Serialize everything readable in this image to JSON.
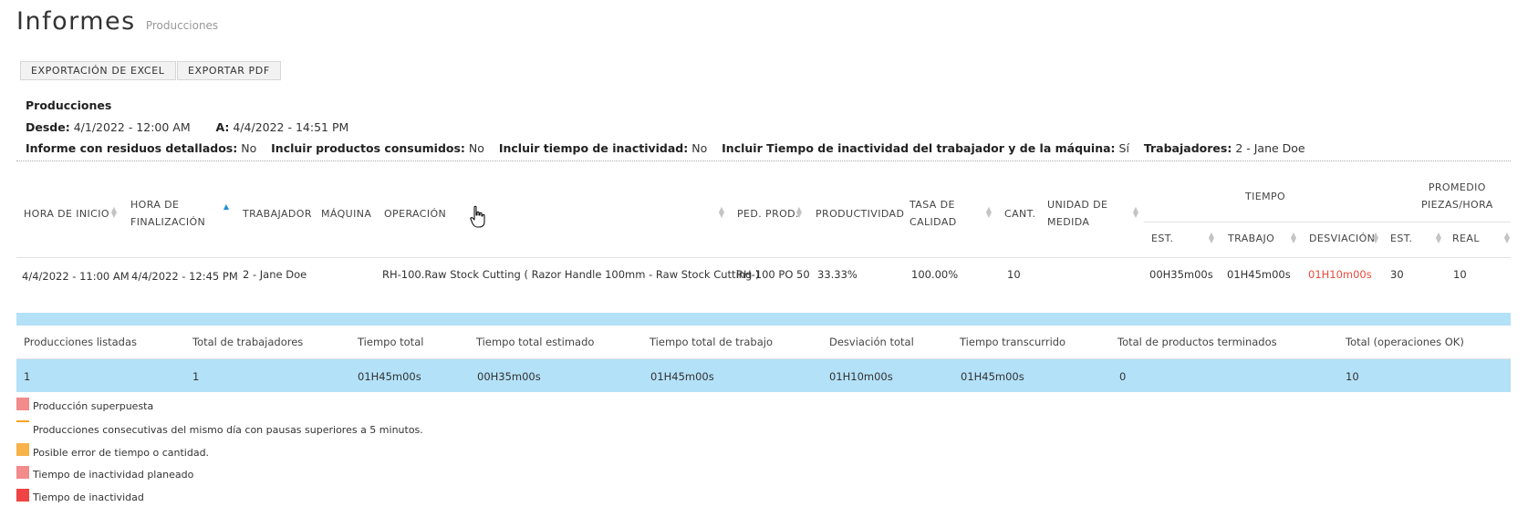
{
  "page": {
    "title": "Informes",
    "subtitle": "Producciones"
  },
  "toolbar": {
    "excel_label": "EXPORTACIÓN DE EXCEL",
    "pdf_label": "EXPORTAR PDF"
  },
  "report": {
    "heading": "Producciones",
    "from_label": "Desde:",
    "from_value": "4/1/2022 - 12:00 AM",
    "to_label": "A:",
    "to_value": "4/4/2022 - 14:51 PM",
    "filters": [
      {
        "label": "Informe con residuos detallados:",
        "value": "No"
      },
      {
        "label": "Incluir productos consumidos:",
        "value": "No"
      },
      {
        "label": "Incluir tiempo de inactividad:",
        "value": "No"
      },
      {
        "label": "Incluir Tiempo de inactividad del trabajador y de la máquina:",
        "value": "Sí"
      },
      {
        "label": "Trabajadores:",
        "value": "2 - Jane Doe"
      }
    ]
  },
  "table": {
    "headers": {
      "start": "HORA DE INICIO",
      "end_1": "HORA DE",
      "end_2": "FINALIZACIÓN",
      "worker": "TRABAJADOR",
      "machine": "MÁQUINA",
      "operation": "OPERACIÓN",
      "order": "PED. PROD.",
      "productivity": "PRODUCTIVIDAD",
      "quality_1": "TASA DE",
      "quality_2": "CALIDAD",
      "qty": "CANT.",
      "unit_1": "UNIDAD DE",
      "unit_2": "MEDIDA",
      "time": "TIEMPO",
      "time_est": "EST.",
      "time_work": "TRABAJO",
      "time_dev": "DESVIACIÓN",
      "avg_1": "PROMEDIO",
      "avg_2": "PIEZAS/HORA",
      "avg_est": "EST.",
      "avg_real": "REAL"
    },
    "rows": [
      {
        "start": "4/4/2022 - 11:00 AM",
        "end": "4/4/2022 - 12:45 PM",
        "worker": "2 - Jane Doe",
        "machine": "",
        "operation": "RH-100.Raw Stock Cutting ( Razor Handle 100mm - Raw Stock Cutting )",
        "order": "RH-100 PO 50",
        "productivity": "33.33%",
        "quality": "100.00%",
        "qty": "10",
        "unit": "",
        "time_est": "00H35m00s",
        "time_work": "01H45m00s",
        "time_dev": "01H10m00s",
        "avg_est": "30",
        "avg_real": "10"
      }
    ]
  },
  "summary": {
    "headers": [
      "Producciones listadas",
      "Total de trabajadores",
      "Tiempo total",
      "Tiempo total estimado",
      "Tiempo total de trabajo",
      "Desviación total",
      "Tiempo transcurrido",
      "Total de productos terminados",
      "Total (operaciones OK)"
    ],
    "values": [
      "1",
      "1",
      "01H45m00s",
      "00H35m00s",
      "01H45m00s",
      "01H10m00s",
      "01H45m00s",
      "0",
      "10"
    ]
  },
  "legend": [
    {
      "label": "Producción superpuesta",
      "color": "#f28b8b"
    },
    {
      "label": "Producciones consecutivas del mismo día con pausas superiores a 5 minutos.",
      "color": "#f5a623"
    },
    {
      "label": "Posible error de tiempo o cantidad.",
      "color": "#f7b24a"
    },
    {
      "label": "Tiempo de inactividad planeado",
      "color": "#f28b8b"
    },
    {
      "label": "Tiempo de inactividad",
      "color": "#f04444"
    }
  ],
  "colors": {
    "accent": "#1e90d6",
    "summary_bg": "#b3e1f8",
    "deviation": "#e74c3c"
  }
}
